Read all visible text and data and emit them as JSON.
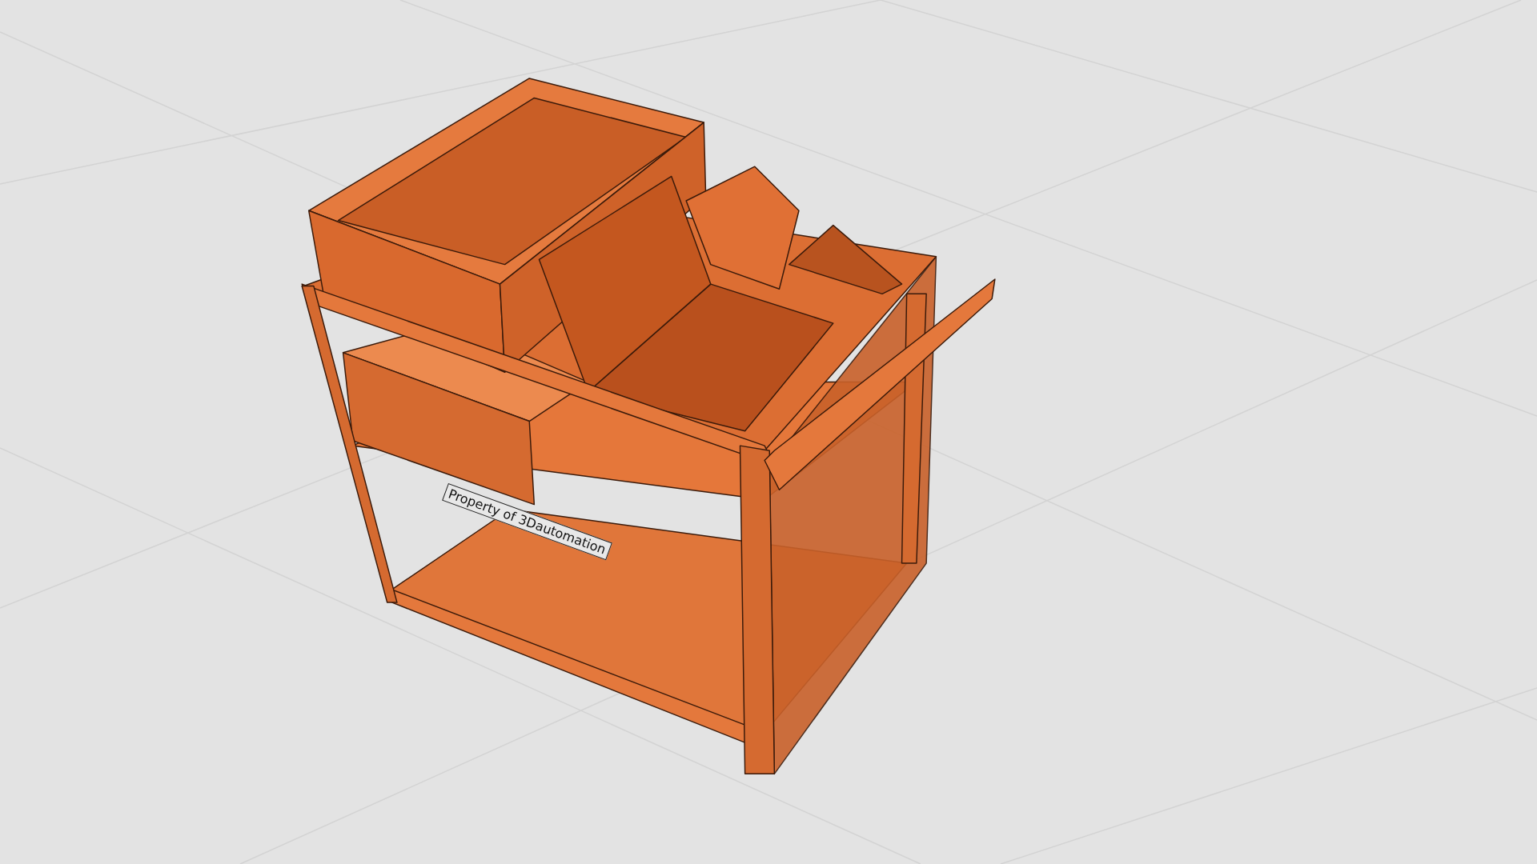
{
  "viewport": {
    "model_label": "Property of 3Dautomation"
  }
}
